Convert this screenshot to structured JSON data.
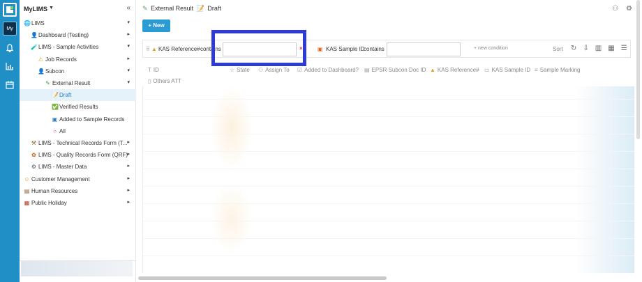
{
  "app": {
    "title": "MyLIMS",
    "rail": {
      "my_label": "My",
      "icons": [
        "app-logo-icon",
        "bell-icon",
        "chart-icon",
        "calendar-icon"
      ]
    }
  },
  "sidebar": {
    "collapse_glyph": "«",
    "items": [
      {
        "label": "LIMS",
        "icon": "globe-icon",
        "glyph": "🌐",
        "indent": 0,
        "caret": "▾",
        "active": false
      },
      {
        "label": "Dashboard (Testing)",
        "icon": "user-icon",
        "glyph": "👤",
        "indent": 1,
        "caret": "▸",
        "active": false
      },
      {
        "label": "LIMS - Sample Activities",
        "icon": "flask-icon",
        "glyph": "🧪",
        "indent": 1,
        "caret": "▾",
        "active": false
      },
      {
        "label": "Job Records",
        "icon": "warning-icon",
        "glyph": "⚠",
        "indent": 2,
        "caret": "▸",
        "active": false
      },
      {
        "label": "Subcon",
        "icon": "person-icon",
        "glyph": "👤",
        "indent": 2,
        "caret": "▾",
        "active": false
      },
      {
        "label": "External Result",
        "icon": "pencil-icon",
        "glyph": "✎",
        "indent": 3,
        "caret": "▾",
        "active": false
      },
      {
        "label": "Draft",
        "icon": "draft-icon",
        "glyph": "📝",
        "indent": 4,
        "caret": "",
        "active": true
      },
      {
        "label": "Verified Results",
        "icon": "check-icon",
        "glyph": "✅",
        "indent": 4,
        "caret": "",
        "active": false
      },
      {
        "label": "Added to Sample Records",
        "icon": "document-icon",
        "glyph": "▣",
        "indent": 4,
        "caret": "",
        "active": false
      },
      {
        "label": "All",
        "icon": "circle-icon",
        "glyph": "○",
        "indent": 4,
        "caret": "",
        "active": false
      },
      {
        "label": "LIMS - Technical Records Form (T...",
        "icon": "tools-icon",
        "glyph": "⚒",
        "indent": 1,
        "caret": "▸",
        "active": false
      },
      {
        "label": "LIMS - Quality Records Form (QRF)",
        "icon": "flower-icon",
        "glyph": "✿",
        "indent": 1,
        "caret": "▸",
        "active": false
      },
      {
        "label": "LIMS - Master Data",
        "icon": "gear-icon",
        "glyph": "⚙",
        "indent": 1,
        "caret": "▸",
        "active": false
      },
      {
        "label": "Customer Management",
        "icon": "smile-icon",
        "glyph": "☺",
        "indent": 0,
        "caret": "▸",
        "active": false
      },
      {
        "label": "Human Resources",
        "icon": "briefcase-icon",
        "glyph": "▤",
        "indent": 0,
        "caret": "▸",
        "active": false
      },
      {
        "label": "Public Holiday",
        "icon": "calendar-icon",
        "glyph": "▦",
        "indent": 0,
        "caret": "▸",
        "active": false
      }
    ]
  },
  "header": {
    "breadcrumb": [
      "External Result",
      "Draft"
    ],
    "breadcrumb_icons": [
      "pencil-icon",
      "draft-icon"
    ]
  },
  "toolbar": {
    "new_label": "+ New"
  },
  "filters": {
    "conditions": [
      {
        "field": "KAS Reference#",
        "operator": "contains",
        "value": "",
        "removable": true
      },
      {
        "field": "KAS Sample ID",
        "operator": "contains",
        "value": "",
        "removable": false
      }
    ],
    "new_condition_label": "+ new condition",
    "sort_label": "Sort",
    "remove_glyph": "×"
  },
  "grid": {
    "columns_row1": [
      "ID",
      "State",
      "Assign To",
      "Added to Dashboard?",
      "EPSR Subcon Doc ID",
      "KAS Reference#",
      "KAS Sample ID",
      "Sample Marking"
    ],
    "columns_row2": [
      "Others ATT"
    ]
  },
  "colors": {
    "accent": "#2b9bd3",
    "rail": "#1f8fc6",
    "highlight_box": "#2d3bd4",
    "remove": "#e0382b"
  }
}
